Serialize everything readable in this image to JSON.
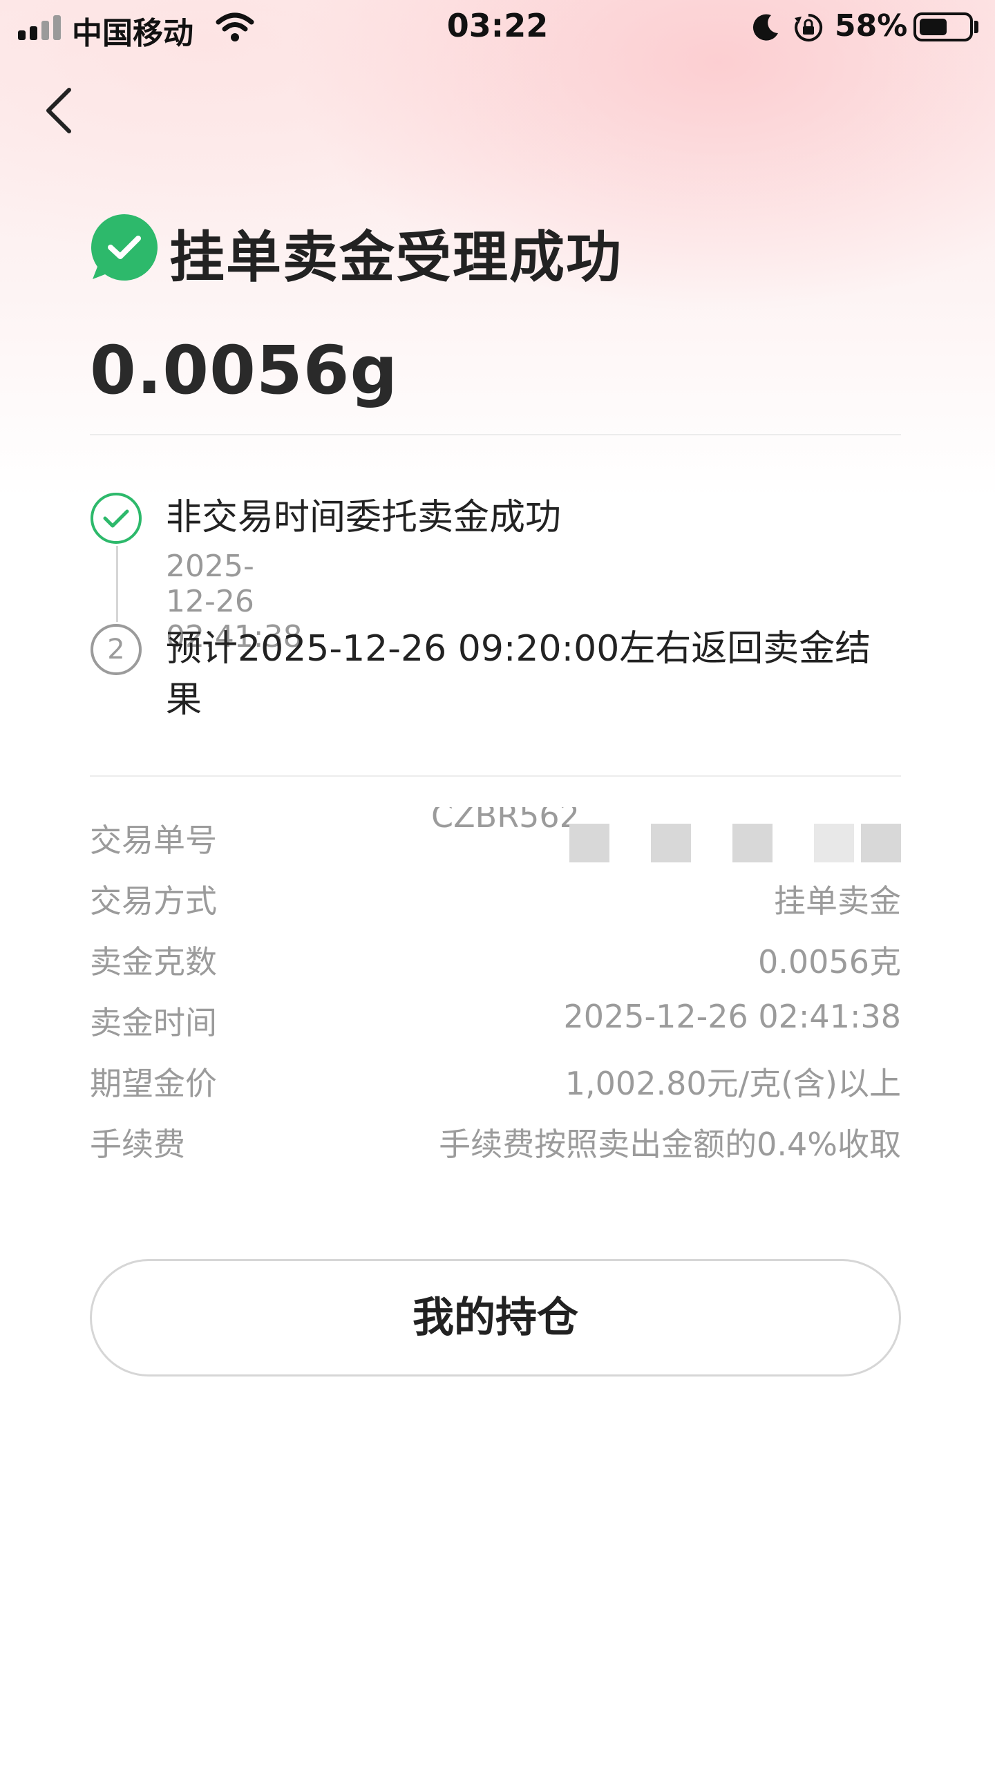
{
  "status_bar": {
    "carrier": "中国移动",
    "time": "03:22",
    "battery": "58%",
    "battery_level": 0.58
  },
  "header": {
    "title": "挂单卖金受理成功",
    "amount": "0.0056g"
  },
  "steps": [
    {
      "text": "非交易时间委托卖金成功",
      "time": "2025-12-26 02:41:38",
      "state": "done"
    },
    {
      "text": "预计2025-12-26 09:20:00左右返回卖金结果",
      "number": "2",
      "state": "pending"
    }
  ],
  "details": {
    "order_no": {
      "label": "交易单号",
      "value_partial": "CZBR562"
    },
    "method": {
      "label": "交易方式",
      "value": "挂单卖金"
    },
    "grams": {
      "label": "卖金克数",
      "value": "0.0056克"
    },
    "time": {
      "label": "卖金时间",
      "value": "2025-12-26 02:41:38"
    },
    "price": {
      "label": "期望金价",
      "value": "1,002.80元/克(含)以上"
    },
    "fee": {
      "label": "手续费",
      "value": "手续费按照卖出金额的0.4%收取"
    }
  },
  "actions": {
    "holdings_button": "我的持仓"
  },
  "colors": {
    "success_green": "#2db96b",
    "text_dark": "#222222",
    "text_muted": "#9b9b9b"
  },
  "icons": {
    "back": "chevron-left-icon",
    "success": "check-bubble-icon",
    "step_done": "check-circle-icon"
  }
}
